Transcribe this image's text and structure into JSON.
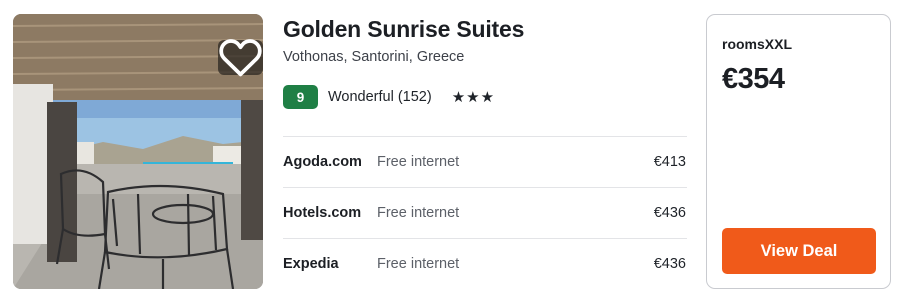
{
  "hotel": {
    "name": "Golden Sunrise Suites",
    "location": "Vothonas, Santorini, Greece",
    "score": "9",
    "rating_label": "Wonderful (152)",
    "stars": "★★★",
    "favorite_icon": "heart-outline-icon"
  },
  "providers": [
    {
      "name": "Agoda.com",
      "feature": "Free internet",
      "price": "€413"
    },
    {
      "name": "Hotels.com",
      "feature": "Free internet",
      "price": "€436"
    },
    {
      "name": "Expedia",
      "feature": "Free internet",
      "price": "€436"
    }
  ],
  "deal": {
    "provider": "roomsXXL",
    "price": "€354",
    "button_label": "View Deal"
  },
  "colors": {
    "score_badge": "#1f7f45",
    "deal_button": "#f05a1a",
    "text_primary": "#1c1f24"
  }
}
